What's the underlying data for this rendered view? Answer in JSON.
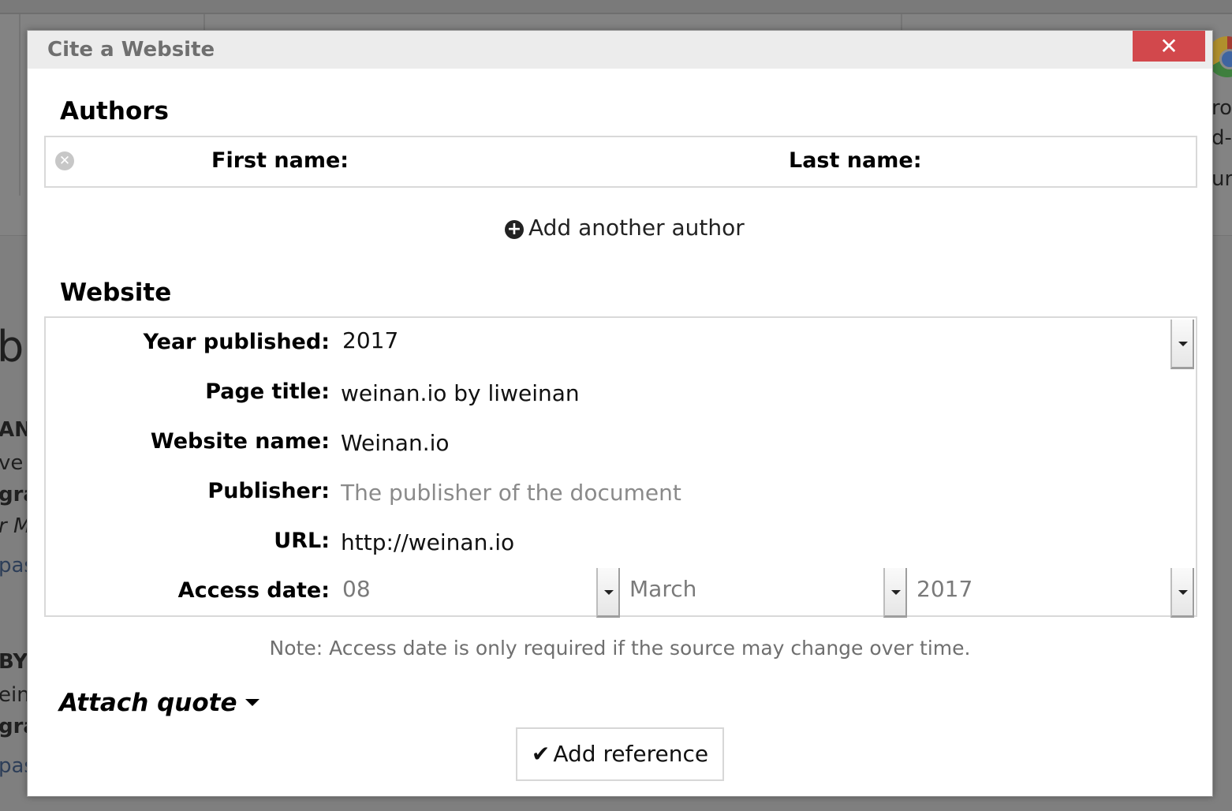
{
  "background": {
    "fragments": [
      "bl",
      "AND",
      "ve",
      "gra",
      "r M",
      "pas",
      "BY",
      "eina",
      "gra",
      "pas",
      "ro",
      "d-c",
      "urc"
    ]
  },
  "dialog": {
    "title": "Cite a Website",
    "close_label": "✕"
  },
  "authors": {
    "heading": "Authors",
    "first_name_label": "First name:",
    "first_name_value": "",
    "last_name_label": "Last name:",
    "last_name_value": "",
    "remove_icon": "⊗",
    "add_another_label": "Add another author"
  },
  "website": {
    "heading": "Website",
    "year_label": "Year published:",
    "year_value": "2017",
    "page_title_label": "Page title:",
    "page_title_value": "weinan.io by liweinan",
    "website_name_label": "Website name:",
    "website_name_value": "Weinan.io",
    "publisher_label": "Publisher:",
    "publisher_value": "",
    "publisher_placeholder": "The publisher of the document",
    "url_label": "URL:",
    "url_value": "http://weinan.io",
    "access_date_label": "Access date:",
    "access_day": "08",
    "access_month": "March",
    "access_year": "2017"
  },
  "note": "Note: Access date is only required if the source may change over time.",
  "attach_quote_label": "Attach quote",
  "add_reference_label": "Add reference",
  "colors": {
    "close_button": "#d2484c",
    "title_text": "#6f6f6f",
    "placeholder": "#8a8a8a"
  },
  "icons": {
    "close": "close-icon",
    "remove": "remove-icon",
    "add": "plus-circle-icon",
    "caret": "caret-down-icon",
    "check": "check-icon"
  }
}
